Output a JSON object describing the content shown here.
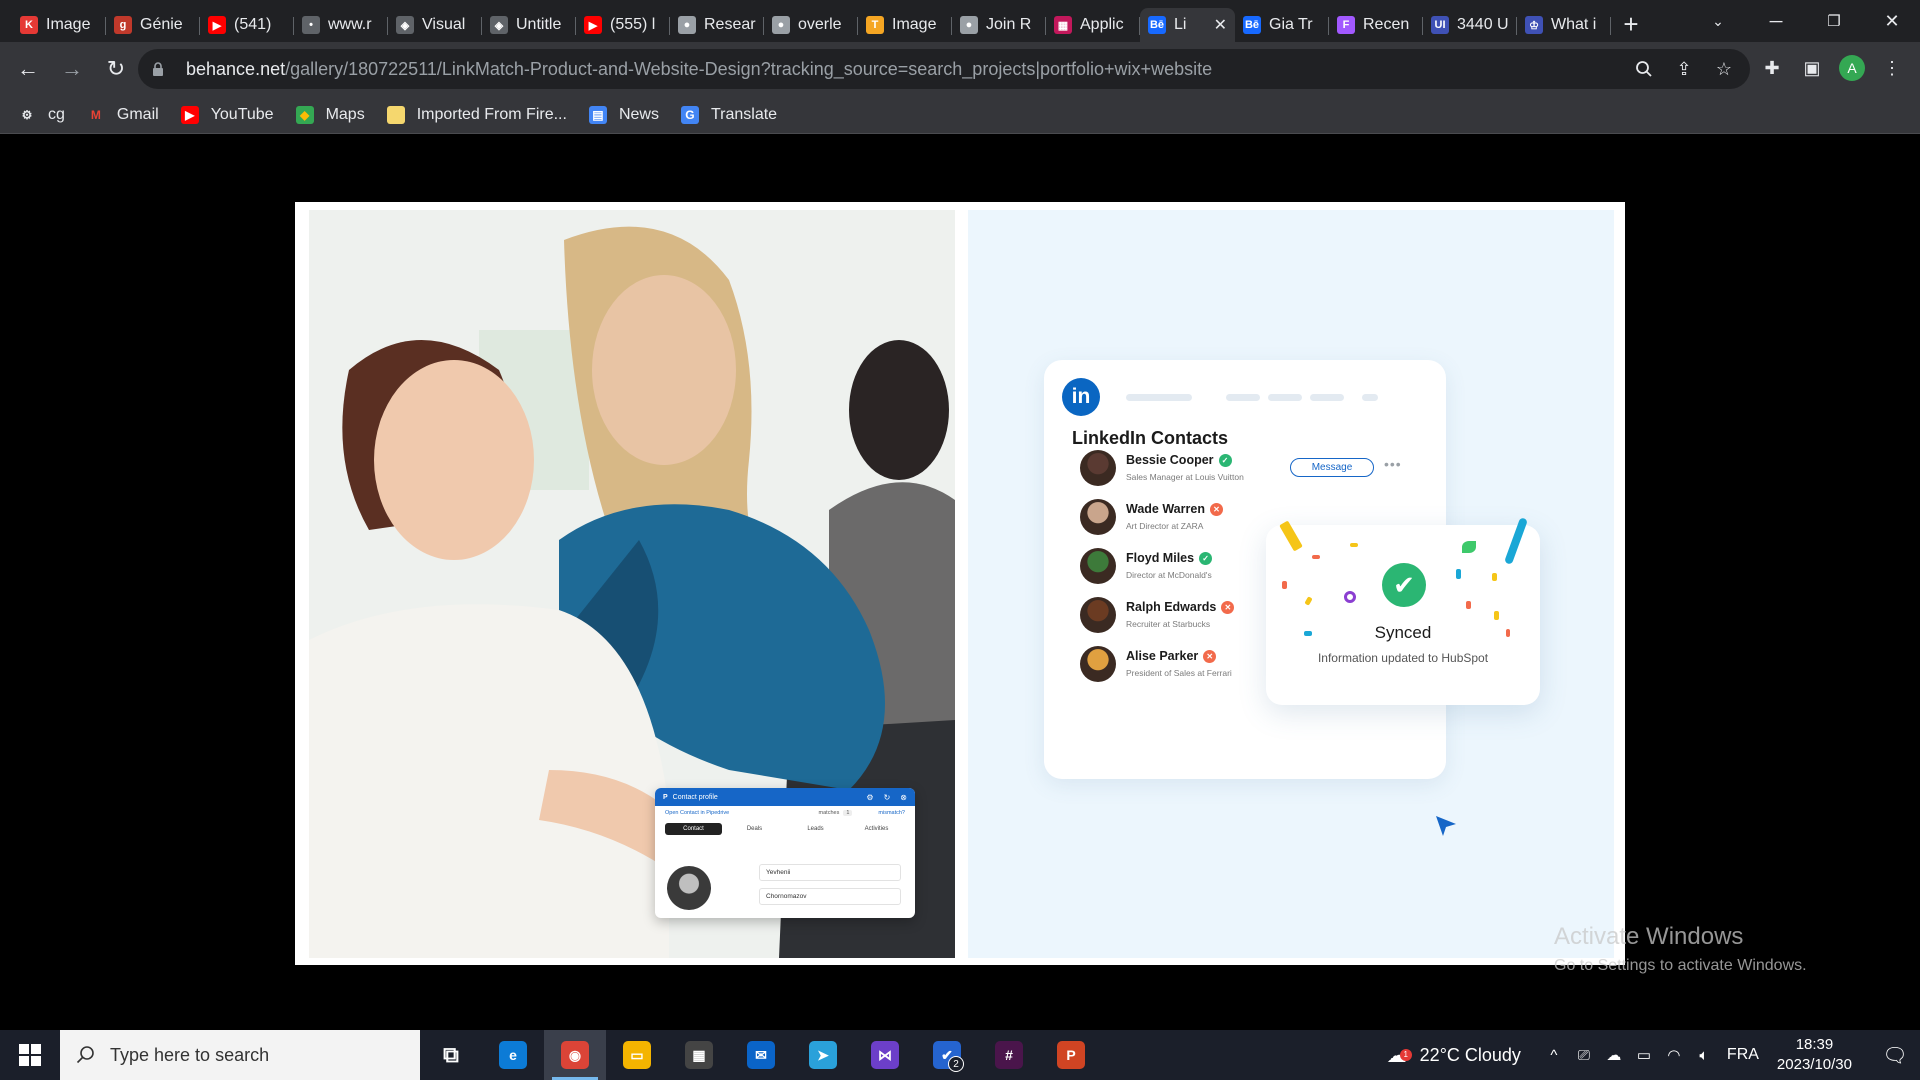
{
  "browser": {
    "tabs": [
      {
        "title": "Image",
        "favicon": "K",
        "color": "#e53935"
      },
      {
        "title": "Génie",
        "favicon": "g",
        "color": "#c0392b"
      },
      {
        "title": "(541)",
        "favicon": "▶",
        "color": "#ff0000"
      },
      {
        "title": "www.r",
        "favicon": "•",
        "color": "#5f6368"
      },
      {
        "title": "Visual",
        "favicon": "◈",
        "color": "#5f6368"
      },
      {
        "title": "Untitle",
        "favicon": "◈",
        "color": "#5f6368"
      },
      {
        "title": "(555) l",
        "favicon": "▶",
        "color": "#ff0000"
      },
      {
        "title": "Resear",
        "favicon": "●",
        "color": "#9aa0a6"
      },
      {
        "title": "overle",
        "favicon": "●",
        "color": "#9aa0a6"
      },
      {
        "title": "Image",
        "favicon": "T",
        "color": "#f5a623"
      },
      {
        "title": "Join R",
        "favicon": "●",
        "color": "#9aa0a6"
      },
      {
        "title": "Applic",
        "favicon": "▦",
        "color": "#c2185b"
      },
      {
        "title": "Li",
        "favicon": "Bē",
        "color": "#1769ff",
        "active": true
      },
      {
        "title": "Gia Tr",
        "favicon": "Bē",
        "color": "#1769ff"
      },
      {
        "title": "Recen",
        "favicon": "F",
        "color": "#a259ff"
      },
      {
        "title": "3440 U",
        "favicon": "UI",
        "color": "#3f51b5"
      },
      {
        "title": "What i",
        "favicon": "♔",
        "color": "#3f51b5"
      }
    ],
    "url_host": "behance.net",
    "url_path": "/gallery/180722511/LinkMatch-Product-and-Website-Design?tracking_source=search_projects|portfolio+wix+website",
    "profile_initial": "A",
    "bookmarks": [
      {
        "label": "cg",
        "icon": "gear-icon"
      },
      {
        "label": "Gmail",
        "icon": "gmail-icon"
      },
      {
        "label": "YouTube",
        "icon": "youtube-icon"
      },
      {
        "label": "Maps",
        "icon": "maps-icon"
      },
      {
        "label": "Imported From Fire...",
        "icon": "folder-icon"
      },
      {
        "label": "News",
        "icon": "news-icon"
      },
      {
        "label": "Translate",
        "icon": "translate-icon"
      }
    ]
  },
  "artwork": {
    "contact_profile": {
      "header": "Contact profile",
      "open_link": "Open Contact in Pipedrive",
      "matches_label": "matches",
      "matches_count": "1",
      "mismatch_label": "mismatch?",
      "tabs": [
        "Contact",
        "Deals",
        "Leads",
        "Activities"
      ],
      "first_name": "Yevhenii",
      "last_name": "Chornomazov"
    },
    "linkedin": {
      "logo_text": "in",
      "title": "LinkedIn Contacts",
      "message_label": "Message",
      "contacts": [
        {
          "name": "Bessie Cooper",
          "role": "Sales Manager at Louis Vuitton",
          "status": "verified",
          "avatar_color": "#5a3a32"
        },
        {
          "name": "Wade Warren",
          "role": "Art Director at ZARA",
          "status": "rejected",
          "avatar_color": "#c9a58c"
        },
        {
          "name": "Floyd Miles",
          "role": "Director at McDonald's",
          "status": "verified",
          "avatar_color": "#3d7a3a"
        },
        {
          "name": "Ralph Edwards",
          "role": "Recruiter at Starbucks",
          "status": "rejected",
          "avatar_color": "#6b3b22"
        },
        {
          "name": "Alise Parker",
          "role": "President of Sales at Ferrari",
          "status": "rejected",
          "avatar_color": "#e0a040"
        }
      ]
    },
    "synced": {
      "title": "Synced",
      "subtitle": "Information updated to HubSpot"
    }
  },
  "watermark": {
    "title": "Activate Windows",
    "subtitle": "Go to Settings to activate Windows."
  },
  "taskbar": {
    "search_placeholder": "Type here to search",
    "weather": "22°C  Cloudy",
    "weather_alert": "1",
    "language": "FRA",
    "time": "18:39",
    "date": "2023/10/30",
    "todo_badge": "2",
    "apps": [
      {
        "name": "task-view",
        "label": "⧉",
        "color": "transparent"
      },
      {
        "name": "edge",
        "label": "e",
        "color": "#0c7bd6"
      },
      {
        "name": "chrome",
        "label": "◉",
        "color": "#db4437",
        "active": true
      },
      {
        "name": "file-explorer",
        "label": "▭",
        "color": "#f4b400"
      },
      {
        "name": "store",
        "label": "▦",
        "color": "#444"
      },
      {
        "name": "mail",
        "label": "✉",
        "color": "#0a64c8"
      },
      {
        "name": "telegram",
        "label": "➤",
        "color": "#2aa1da"
      },
      {
        "name": "visual-studio",
        "label": "⋈",
        "color": "#6c3fc9"
      },
      {
        "name": "todo",
        "label": "✔",
        "color": "#2564cf"
      },
      {
        "name": "slack",
        "label": "#",
        "color": "#4a154b"
      },
      {
        "name": "powerpoint",
        "label": "P",
        "color": "#d04423"
      }
    ]
  },
  "colors": {
    "accent_blue": "#1666c7",
    "linkedin_blue": "#0a66c2",
    "success_green": "#2bb673",
    "error_orange": "#f26a4b"
  }
}
